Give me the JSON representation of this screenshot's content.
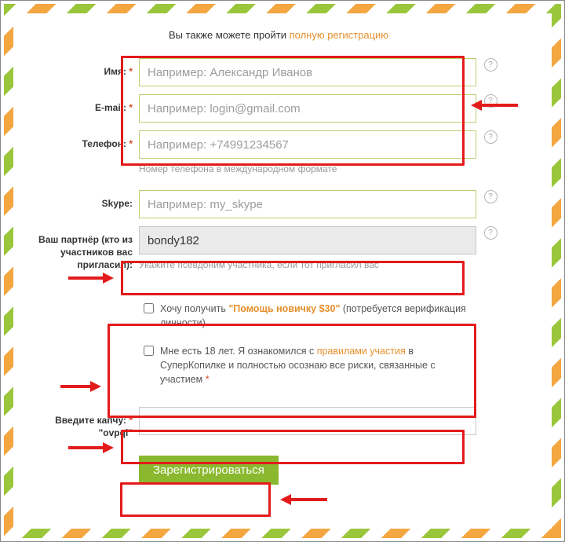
{
  "intro": {
    "text_before": "Вы также можете пройти ",
    "link": "полную регистрацию"
  },
  "labels": {
    "name": "Имя:",
    "email": "E-mail:",
    "phone": "Телефон:",
    "skype": "Skype:",
    "partner": "Ваш партнёр (кто из участников вас пригласил):",
    "captcha_l1": "Введите капчу:",
    "captcha_l2": "\"ovpqi\"",
    "asterisk": "*"
  },
  "placeholders": {
    "name": "Например: Александр Иванов",
    "email": "Например: login@gmail.com",
    "phone": "Например: +74991234567",
    "skype": "Например: my_skype"
  },
  "values": {
    "partner": "bondy182"
  },
  "hints": {
    "phone": "Номер телефона в международном формате",
    "partner": "Укажите псевдоним участника, если тот пригласил вас"
  },
  "checkboxes": {
    "bonus_before": "Хочу получить ",
    "bonus_hl": "\"Помощь новичку $30\"",
    "bonus_after": " (потребуется верификация личности)",
    "age_before": "Мне есть 18 лет. Я ознакомился с ",
    "age_link": "правилами участия",
    "age_after": " в СуперКопилке и полностью осознаю все риски, связанные с участием ",
    "age_ast": "*"
  },
  "buttons": {
    "submit": "Зарегистрироваться"
  },
  "help_glyph": "?"
}
